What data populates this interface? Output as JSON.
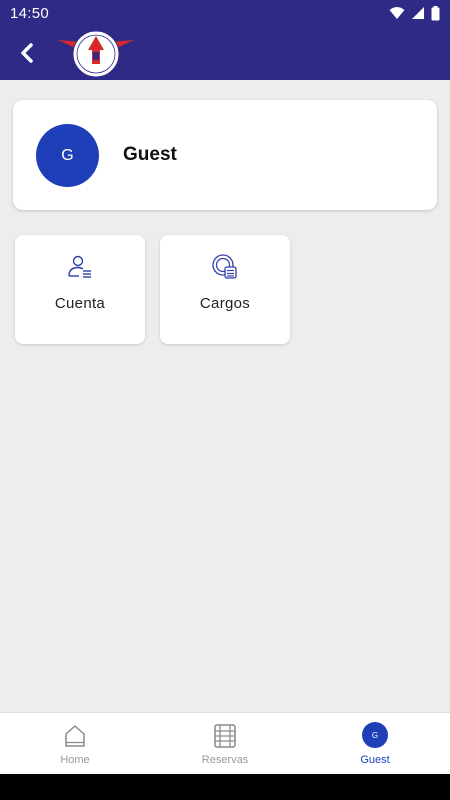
{
  "status_bar": {
    "time": "14:50",
    "icons": [
      "wifi-icon",
      "signal-icon",
      "battery-icon"
    ]
  },
  "app_bar": {
    "back_icon": "chevron-left-icon",
    "logo": "club-logo"
  },
  "profile": {
    "avatar_initial": "G",
    "name": "Guest"
  },
  "tiles": [
    {
      "label": "Cuenta",
      "icon": "user-list-icon"
    },
    {
      "label": "Cargos",
      "icon": "coins-icon"
    }
  ],
  "bottom_nav": {
    "items": [
      {
        "label": "Home",
        "icon": "home-icon",
        "active": false
      },
      {
        "label": "Reservas",
        "icon": "calendar-grid-icon",
        "active": false
      },
      {
        "label": "Guest",
        "avatar_initial": "G",
        "active": true
      }
    ]
  },
  "colors": {
    "header": "#2f2a85",
    "accent": "#1f3fb8",
    "background": "#ededed"
  }
}
